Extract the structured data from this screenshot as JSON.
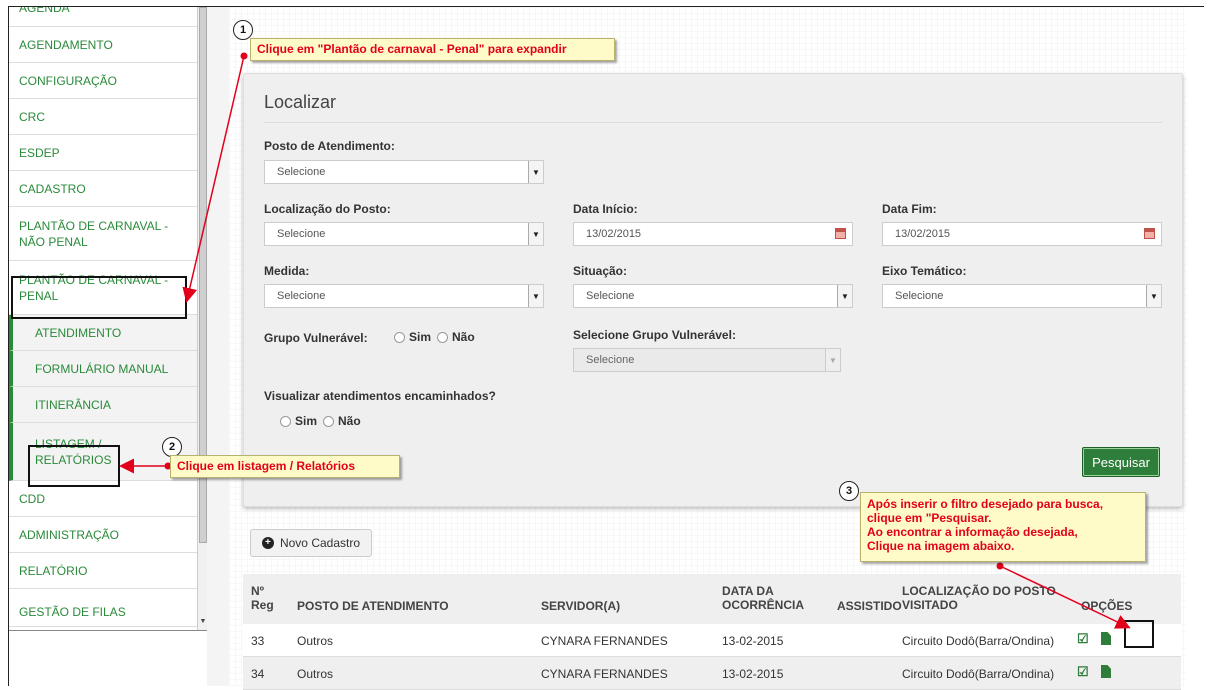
{
  "sidebar": {
    "items": [
      {
        "label": "AGENDA"
      },
      {
        "label": "AGENDAMENTO"
      },
      {
        "label": "CONFIGURAÇÃO"
      },
      {
        "label": "CRC"
      },
      {
        "label": "ESDEP"
      },
      {
        "label": "CADASTRO"
      },
      {
        "label": "PLANTÃO DE CARNAVAL - NÃO PENAL"
      },
      {
        "label": "PLANTÃO DE CARNAVAL - PENAL"
      },
      {
        "label": "ATENDIMENTO"
      },
      {
        "label": "FORMULÁRIO MANUAL"
      },
      {
        "label": "ITINERÂNCIA"
      },
      {
        "label": "LISTAGEM / RELATÓRIOS"
      },
      {
        "label": "CDD"
      },
      {
        "label": "ADMINISTRAÇÃO"
      },
      {
        "label": "RELATÓRIO"
      },
      {
        "label": "GESTÃO DE FILAS"
      }
    ]
  },
  "form": {
    "title": "Localizar",
    "posto_label": "Posto de Atendimento:",
    "posto_value": "Selecione",
    "localizacao_label": "Localização do Posto:",
    "localizacao_value": "Selecione",
    "data_inicio_label": "Data Início:",
    "data_inicio_value": "13/02/2015",
    "data_fim_label": "Data Fim:",
    "data_fim_value": "13/02/2015",
    "medida_label": "Medida:",
    "medida_value": "Selecione",
    "situacao_label": "Situação:",
    "situacao_value": "Selecione",
    "eixo_label": "Eixo Temático:",
    "eixo_value": "Selecione",
    "grupo_label": "Grupo Vulnerável:",
    "sim": "Sim",
    "nao": "Não",
    "sel_grupo_label": "Selecione Grupo Vulnerável:",
    "sel_grupo_value": "Selecione",
    "visualizar_label": "Visualizar atendimentos encaminhados?",
    "search_button": "Pesquisar"
  },
  "new_button": "Novo Cadastro",
  "table": {
    "headers": {
      "nreg": "Nº Reg",
      "posto": "POSTO DE ATENDIMENTO",
      "servidor": "SERVIDOR(A)",
      "data": "DATA DA OCORRÊNCIA",
      "assistido": "ASSISTIDO",
      "localizacao": "LOCALIZAÇÃO DO POSTO VISITADO",
      "opcoes": "OPÇÕES"
    },
    "rows": [
      {
        "nreg": "33",
        "posto": "Outros",
        "servidor": "CYNARA FERNANDES",
        "data": "13-02-2015",
        "assistido": "",
        "localizacao": "Circuito Dodô(Barra/Ondina)"
      },
      {
        "nreg": "34",
        "posto": "Outros",
        "servidor": "CYNARA FERNANDES",
        "data": "13-02-2015",
        "assistido": "",
        "localizacao": "Circuito Dodô(Barra/Ondina)"
      }
    ]
  },
  "annotations": {
    "step1_number": "1",
    "step1_text": "Clique em \"Plantão de carnaval - Penal\" para expandir",
    "step2_number": "2",
    "step2_text": "Clique em listagem / Relatórios",
    "step3_number": "3",
    "step3_line1": "Após inserir o filtro desejado para busca,",
    "step3_line2": "clique em \"Pesquisar.",
    "step3_line3": "Ao encontrar a informação desejada,",
    "step3_line4": "Clique na imagem abaixo."
  },
  "icons": [
    "plus-circle-icon",
    "calendar-icon",
    "edit-icon",
    "document-icon",
    "chevron-down-icon"
  ],
  "colors": {
    "accent": "#2e7d3a",
    "annotation_text": "#e2001a",
    "callout_bg": "#fffbc8"
  }
}
